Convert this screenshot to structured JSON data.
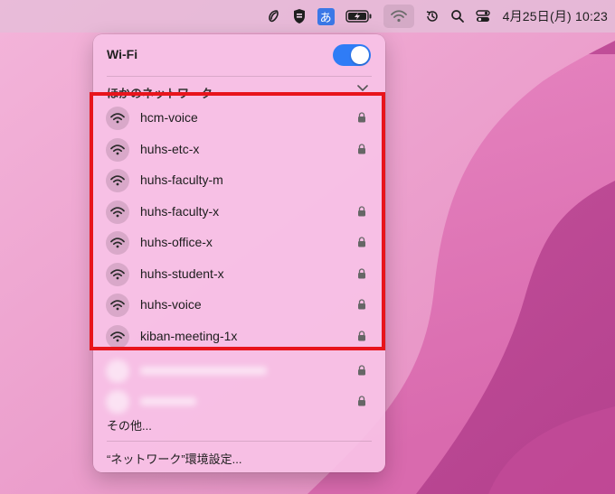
{
  "colors": {
    "highlight": "#e8141c",
    "toggle_on": "#2f7cf6",
    "ime_badge": "#3b78e7",
    "menu_bg": "#f7c2e6"
  },
  "menubar": {
    "icons": [
      "script-logo-icon",
      "app-shield-icon",
      "input-method-icon",
      "battery-charging-icon",
      "wifi-icon",
      "time-machine-icon",
      "spotlight-search-icon",
      "control-center-icon"
    ],
    "input_method_label": "あ",
    "clock": "4月25日(月) 10:23"
  },
  "wifi_menu": {
    "title": "Wi-Fi",
    "toggle_state": "on",
    "other_networks_header": "ほかのネットワーク",
    "networks": [
      {
        "name": "hcm-voice",
        "locked": true
      },
      {
        "name": "huhs-etc-x",
        "locked": true
      },
      {
        "name": "huhs-faculty-m",
        "locked": false
      },
      {
        "name": "huhs-faculty-x",
        "locked": true
      },
      {
        "name": "huhs-office-x",
        "locked": true
      },
      {
        "name": "huhs-student-x",
        "locked": true
      },
      {
        "name": "huhs-voice",
        "locked": true
      },
      {
        "name": "kiban-meeting-1x",
        "locked": true
      }
    ],
    "blurred_networks_count": 2,
    "other_item": "その他...",
    "network_prefs": "“ネットワーク”環境設定..."
  }
}
